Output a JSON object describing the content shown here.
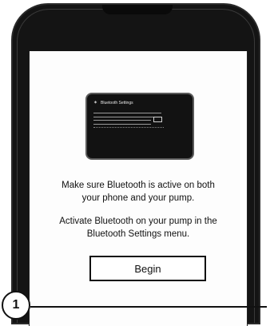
{
  "pump_screen": {
    "bluetooth_icon": "bluetooth-icon",
    "title": "Bluetooth Settings"
  },
  "instructions": {
    "line1a": "Make sure Bluetooth is active on both",
    "line1b": "your phone and your pump.",
    "line2a": "Activate Bluetooth on your pump in the",
    "line2b": "Bluetooth Settings menu."
  },
  "begin_button": {
    "label": "Begin"
  },
  "step": {
    "number": "1"
  }
}
